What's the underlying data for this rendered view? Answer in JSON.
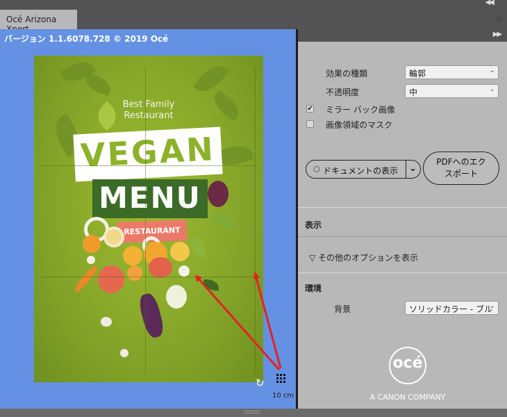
{
  "window": {
    "tab_title": "Océ Arizona Xpert",
    "collapse_icon": "double-chevron-left-icon",
    "panel_menu_icon": "hamburger-menu-icon"
  },
  "preview": {
    "version_text": "バージョン 1.1.6078.728 © 2019 Océ",
    "scale_label": "10 cm",
    "background_color": "#6491e3",
    "poster": {
      "subtitle_line1": "Best Family",
      "subtitle_line2": "Restaurant",
      "title_1": "VEGAN",
      "title_2": "MENU",
      "badge": "RESTAURANT"
    },
    "rotate_icon": "rotate-icon",
    "grid_icon": "grid-icon",
    "arrow_color": "#e52222"
  },
  "sidebar": {
    "expand_icon": "double-chevron-right-icon",
    "effect_type_label": "効果の種類",
    "effect_type_value": "輪郭",
    "opacity_label": "不透明度",
    "opacity_value": "中",
    "mirror_back_label": "ミラー バック画像",
    "mirror_back_checked": true,
    "image_mask_label": "画像領域のマスク",
    "image_mask_checked": false,
    "show_document_button": "ドキュメントの表示",
    "pdf_export_line1": "PDFへのエク",
    "pdf_export_line2": "スポート",
    "display_section": "表示",
    "more_options": "▽ その他のオプションを表示",
    "environment_section": "環境",
    "background_label": "背景",
    "background_value": "ソリッドカラー - ブル",
    "logo_text": "océ",
    "logo_subtitle": "A CANON COMPANY"
  }
}
